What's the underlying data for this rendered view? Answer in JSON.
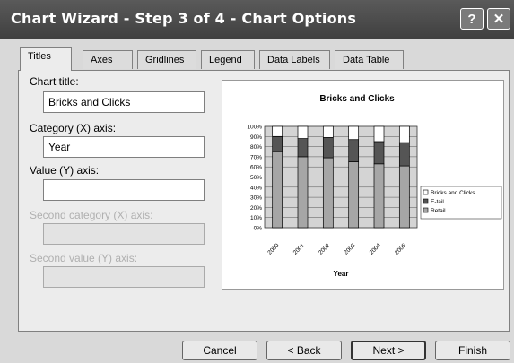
{
  "window": {
    "title": "Chart Wizard - Step 3 of 4 - Chart Options",
    "help_button": "?",
    "close_button": "✕"
  },
  "tabs": [
    {
      "label": "Titles",
      "active": true
    },
    {
      "label": "Axes"
    },
    {
      "label": "Gridlines"
    },
    {
      "label": "Legend"
    },
    {
      "label": "Data Labels"
    },
    {
      "label": "Data Table"
    }
  ],
  "form": {
    "chart_title_label": "Chart title:",
    "chart_title_value": "Bricks and Clicks",
    "category_x_label": "Category (X) axis:",
    "category_x_value": "Year",
    "value_y_label": "Value (Y) axis:",
    "value_y_value": "",
    "second_category_label": "Second category (X) axis:",
    "second_value_label": "Second value (Y) axis:"
  },
  "chart_data": {
    "type": "bar",
    "stacked": "100%",
    "title": "Bricks and Clicks",
    "xlabel": "Year",
    "ylabel": "",
    "ylim": [
      0,
      100
    ],
    "yticks": [
      "0%",
      "10%",
      "20%",
      "30%",
      "40%",
      "50%",
      "60%",
      "70%",
      "80%",
      "90%",
      "100%"
    ],
    "categories": [
      "2000",
      "2001",
      "2002",
      "2003",
      "2004",
      "2005"
    ],
    "series": [
      {
        "name": "Retail",
        "values": [
          75,
          70,
          69,
          65,
          63,
          61
        ],
        "color": "#a6a6a6"
      },
      {
        "name": "E-tail",
        "values": [
          15,
          18,
          20,
          22,
          22,
          23
        ],
        "color": "#555555"
      },
      {
        "name": "Bricks and Clicks",
        "values": [
          10,
          12,
          11,
          13,
          15,
          16
        ],
        "color": "#ffffff"
      }
    ],
    "legend_order": [
      "Bricks and Clicks",
      "E-tail",
      "Retail"
    ],
    "legend_position": "right",
    "plot_background": "#d4d4d4",
    "grid": true
  },
  "buttons": {
    "cancel": "Cancel",
    "back": "< Back",
    "next": "Next >",
    "finish": "Finish"
  }
}
